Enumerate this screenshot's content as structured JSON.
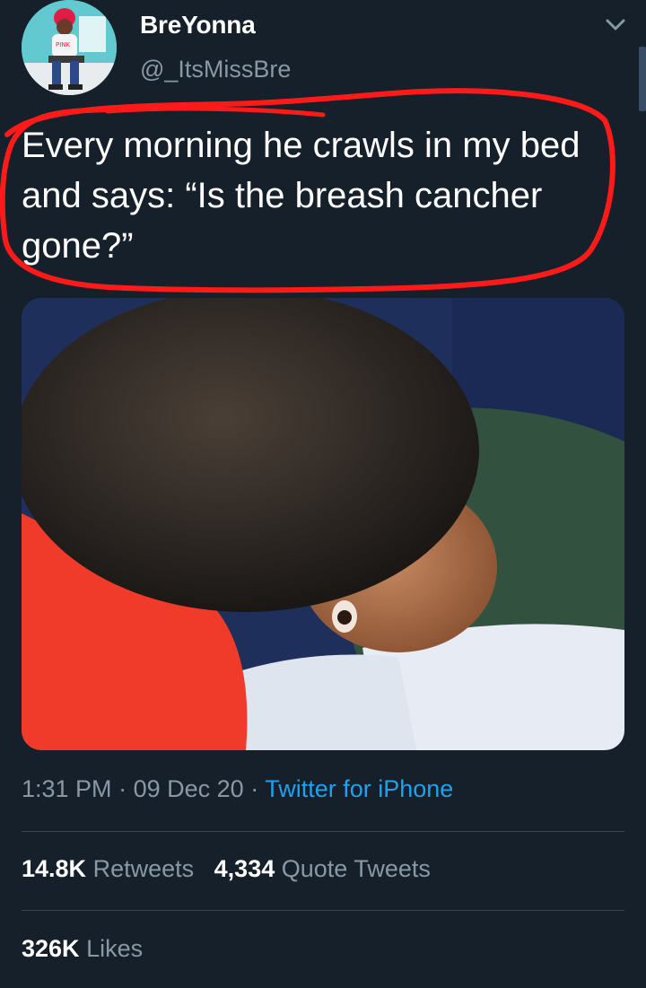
{
  "user": {
    "display_name": "BreYonna",
    "handle": "@_ItsMissBre"
  },
  "tweet": {
    "text": "Every morning he crawls in my bed and says: “Is the breash cancher gone?”",
    "time": "1:31 PM",
    "separator": "·",
    "date": "09 Dec 20",
    "source": "Twitter for iPhone"
  },
  "stats": {
    "retweets_count": "14.8K",
    "retweets_label": "Retweets",
    "quotes_count": "4,334",
    "quotes_label": "Quote Tweets",
    "likes_count": "326K",
    "likes_label": "Likes"
  },
  "icons": {
    "more": "chevron-down-icon"
  },
  "colors": {
    "background": "#15202b",
    "accent": "#1da1f2",
    "secondary_text": "#8899a6",
    "annotation": "#ff1a1a"
  }
}
